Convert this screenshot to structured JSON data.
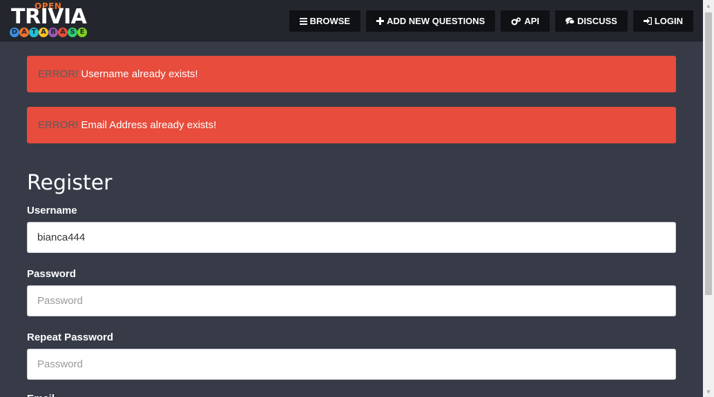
{
  "logo": {
    "open": "OPEN",
    "trivia": "TRIVIA",
    "database_letters": [
      "D",
      "A",
      "T",
      "A",
      "B",
      "A",
      "S",
      "E"
    ],
    "database_colors": [
      "#3b8ee0",
      "#f0712d",
      "#21c0d8",
      "#f6c324",
      "#9b59b6",
      "#e74c3c",
      "#2ecc71",
      "#7ed321"
    ]
  },
  "nav": {
    "browse": "BROWSE",
    "add_new_questions": "ADD NEW QUESTIONS",
    "api": "API",
    "discuss": "DISCUSS",
    "login": "LOGIN"
  },
  "alerts": [
    {
      "prefix": "ERROR!",
      "message": "Username already exists!"
    },
    {
      "prefix": "ERROR!",
      "message": "Email Address already exists!"
    }
  ],
  "form": {
    "title": "Register",
    "username_label": "Username",
    "username_value": "bianca444",
    "password_label": "Password",
    "password_placeholder": "Password",
    "repeat_password_label": "Repeat Password",
    "repeat_password_placeholder": "Password",
    "next_label_partial": "Email"
  },
  "colors": {
    "navbar": "#23262d",
    "background": "#373b48",
    "alert": "#e74c3c",
    "button": "#0f1115"
  }
}
